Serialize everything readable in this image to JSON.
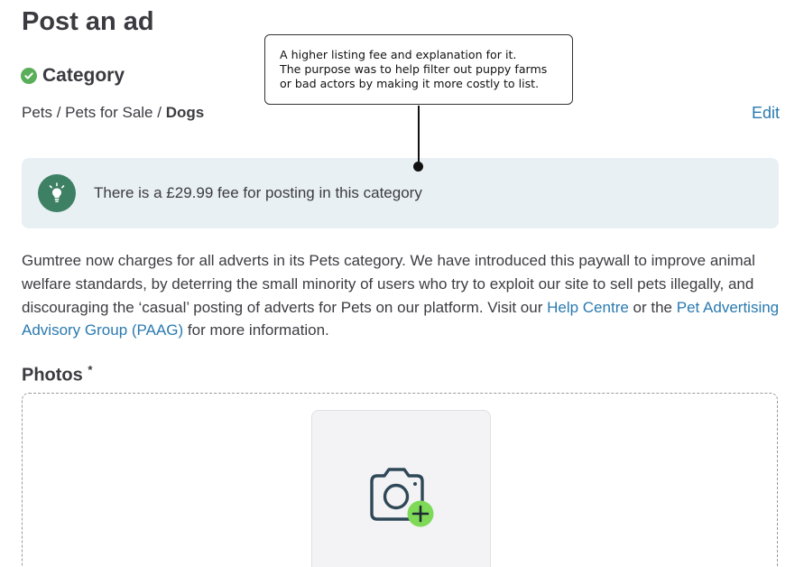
{
  "page": {
    "title": "Post an ad"
  },
  "category": {
    "heading": "Category",
    "status_icon": "check-circle-icon",
    "status_color": "#5aae5a",
    "breadcrumb": {
      "path_prefix": "Pets / Pets for Sale / ",
      "current": "Dogs"
    },
    "edit_label": "Edit"
  },
  "fee_banner": {
    "icon": "lightbulb-icon",
    "icon_color": "#3d8063",
    "text": "There is a £29.99 fee for posting in this category"
  },
  "info": {
    "text_1": "Gumtree now charges for all adverts in its Pets category. We have introduced this paywall to improve animal welfare standards, by deterring the small minority of users who try to exploit our site to sell pets illegally, and discouraging the ‘casual’ posting of adverts for Pets on our platform. Visit our ",
    "link_help": "Help Centre",
    "text_2": " or the ",
    "link_paag": "Pet Advertising Advisory Group (PAAG)",
    "text_3": " for more information.",
    "link_color": "#2a7ab0"
  },
  "photos": {
    "heading": "Photos",
    "required_marker": "*",
    "upload_icon": "camera-add-icon",
    "accent_color": "#7ed957"
  },
  "annotation": {
    "line_1": "A higher listing fee and explanation for it.",
    "line_2": "The purpose was to help filter out puppy farms",
    "line_3": "or bad actors by making it more costly to list."
  }
}
